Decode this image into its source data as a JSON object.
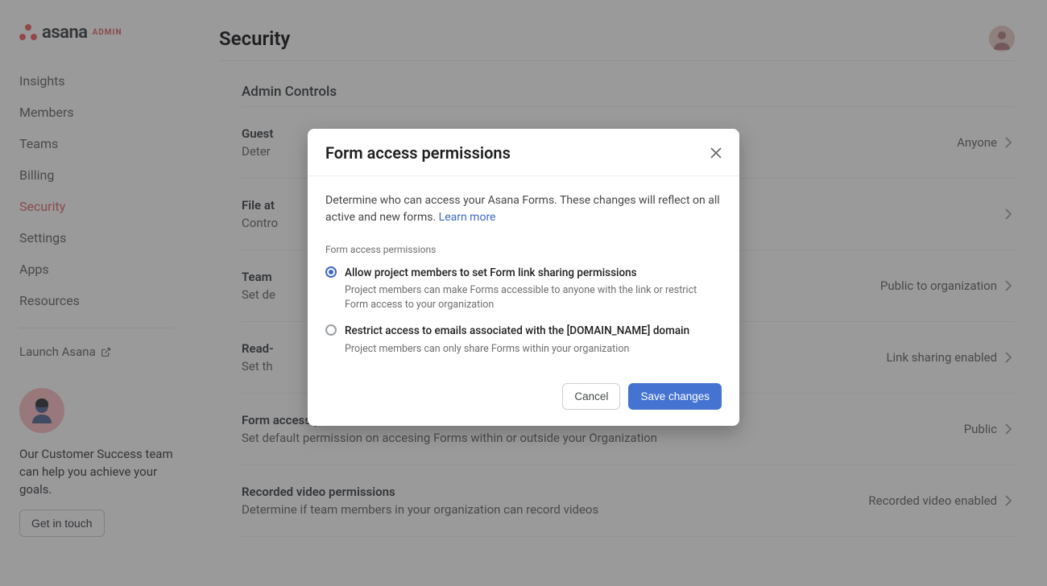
{
  "brand": {
    "word": "asana",
    "admin": "ADMIN"
  },
  "sidebar": {
    "items": [
      {
        "label": "Insights"
      },
      {
        "label": "Members"
      },
      {
        "label": "Teams"
      },
      {
        "label": "Billing"
      },
      {
        "label": "Security"
      },
      {
        "label": "Settings"
      },
      {
        "label": "Apps"
      },
      {
        "label": "Resources"
      }
    ],
    "launch": "Launch Asana",
    "cs_text": "Our Customer Success team can help you achieve your goals.",
    "cs_button": "Get in touch"
  },
  "page": {
    "title": "Security",
    "section": "Admin Controls"
  },
  "rows": [
    {
      "title": "Guest",
      "desc": "Deter",
      "value": "Anyone"
    },
    {
      "title": "File at",
      "desc": "Contro",
      "value": ""
    },
    {
      "title": "Team",
      "desc": "Set de",
      "value": "Public to organization"
    },
    {
      "title": "Read-",
      "desc": "Set th",
      "value": "Link sharing enabled"
    },
    {
      "title": "Form access permissions",
      "desc": "Set default permission on accesing Forms within or outside your Organization",
      "value": "Public"
    },
    {
      "title": "Recorded video permissions",
      "desc": "Determine if team members in your organization can record videos",
      "value": "Recorded video enabled"
    }
  ],
  "dialog": {
    "title": "Form access permissions",
    "body": "Determine who can access your Asana Forms. These changes will reflect on all active and new forms.",
    "learn_more": "Learn more",
    "subhead": "Form access permissions",
    "options": [
      {
        "label": "Allow project members to set Form link sharing permissions",
        "desc": "Project members can make Forms accessible to anyone with the link or restrict Form access to your organization",
        "selected": true
      },
      {
        "label": "Restrict access to emails associated with the [DOMAIN_NAME] domain",
        "desc": "Project members can only share Forms within your organization",
        "selected": false
      }
    ],
    "cancel": "Cancel",
    "save": "Save changes"
  }
}
